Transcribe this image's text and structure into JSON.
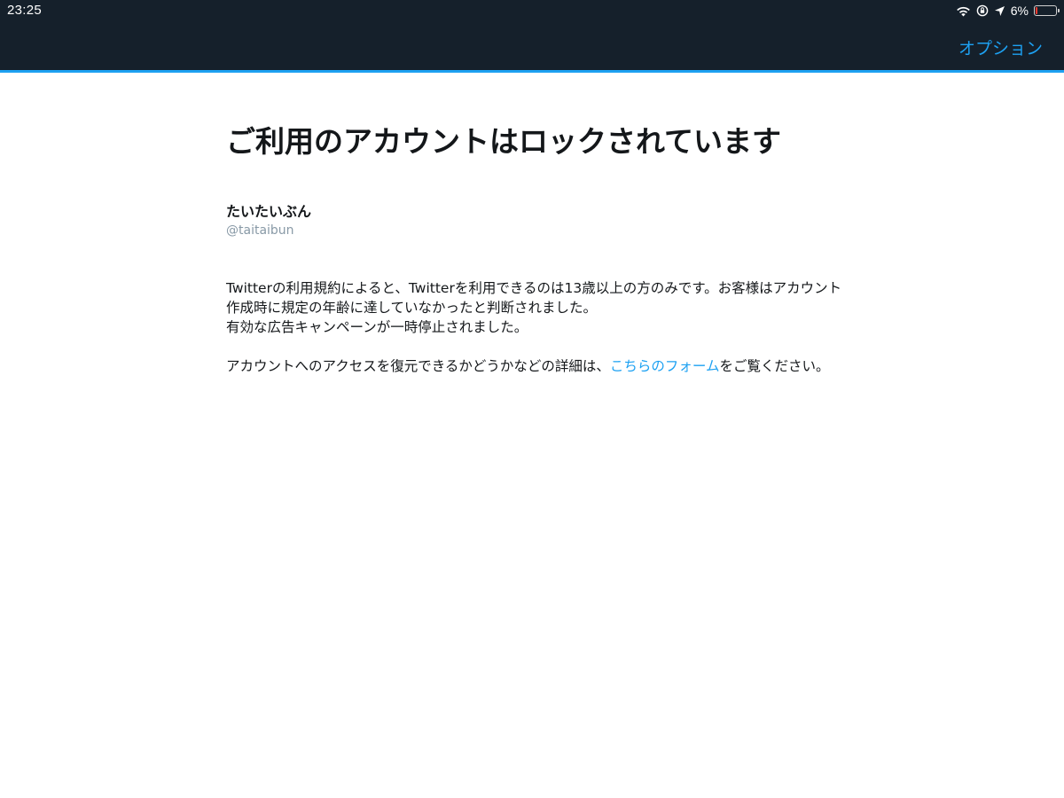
{
  "status_bar": {
    "time": "23:25",
    "battery_percent": "6%",
    "battery_level": 0.06,
    "icons": [
      "wifi-icon",
      "orientation-lock-icon",
      "location-arrow-icon",
      "battery-icon"
    ]
  },
  "header": {
    "options_label": "オプション"
  },
  "main": {
    "title": "ご利用のアカウントはロックされています",
    "account_name": "たいたいぶん",
    "account_handle": "@taitaibun",
    "paragraph1": "Twitterの利用規約によると、Twitterを利用できるのは13歳以上の方のみです。お客様はアカウント作成時に規定の年齢に達していなかったと判断されました。",
    "paragraph2": "有効な広告キャンペーンが一時停止されました。",
    "paragraph3_before": "アカウントへのアクセスを復元できるかどうかなどの詳細は、",
    "paragraph3_link": "こちらのフォーム",
    "paragraph3_after": "をご覧ください。"
  },
  "colors": {
    "header_bg": "#15202b",
    "accent": "#1da1f2",
    "text": "#14171a",
    "muted": "#8899a6",
    "battery_low": "#ff3b30"
  }
}
